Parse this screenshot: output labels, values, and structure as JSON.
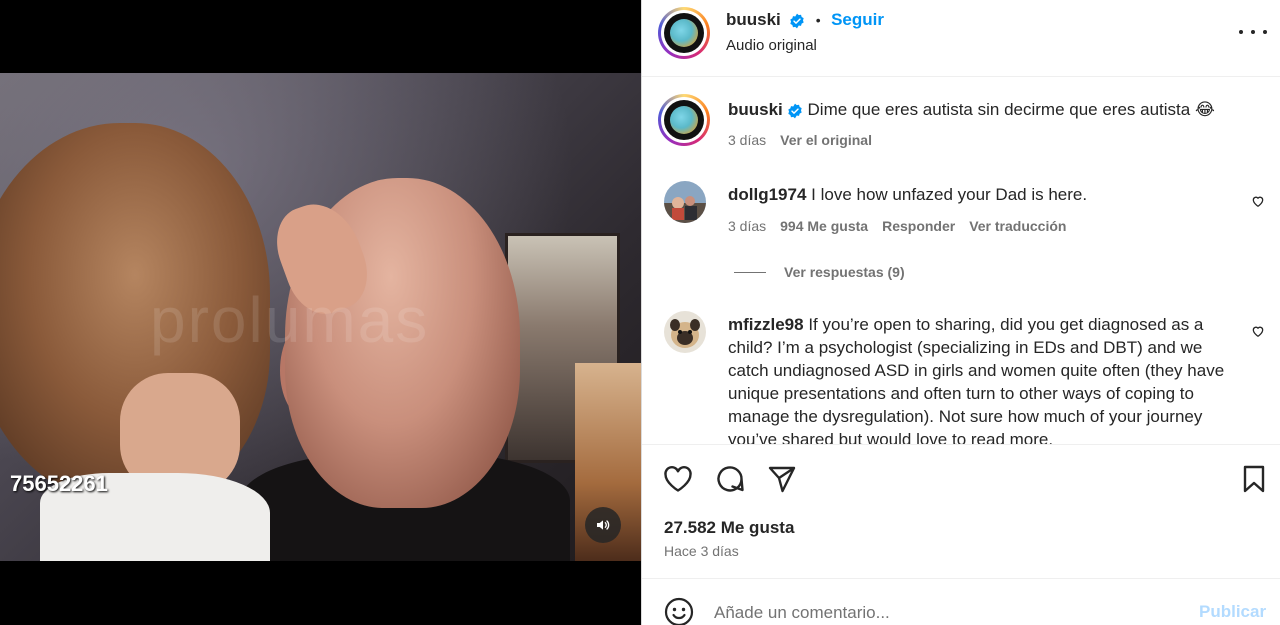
{
  "media": {
    "overlay_code": "75652261",
    "watermark": "prolumas",
    "sound_icon": "speaker-icon"
  },
  "header": {
    "username": "buuski",
    "dot": "•",
    "follow_label": "Seguir",
    "audio_label": "Audio original",
    "more_icon": "more-options-icon"
  },
  "caption": {
    "username": "buuski",
    "text": "Dime que eres autista sin decirme que eres autista 😂",
    "time": "3 días",
    "see_original": "Ver el original"
  },
  "comments": [
    {
      "username": "dollg1974",
      "text": "I love how unfazed your Dad is here.",
      "time": "3 días",
      "likes": "994 Me gusta",
      "reply": "Responder",
      "translate": "Ver traducción",
      "view_replies": "Ver respuestas (9)"
    },
    {
      "username": "mfizzle98",
      "text": "If you’re open to sharing, did you get diagnosed as a child? I’m a psychologist (specializing in EDs and DBT) and we catch undiagnosed ASD in girls and women quite often (they have unique presentations and often turn to other ways of coping to manage the dysregulation). Not sure how much of your journey you’ve shared but would love to read more."
    }
  ],
  "actions": {
    "likes": "27.582 Me gusta",
    "ago": "Hace 3 días"
  },
  "composer": {
    "placeholder": "Añade un comentario...",
    "publish_label": "Publicar"
  },
  "colors": {
    "accent": "#0095f6",
    "publish_disabled": "#b3dbff",
    "text": "#262626",
    "muted": "#737373"
  }
}
